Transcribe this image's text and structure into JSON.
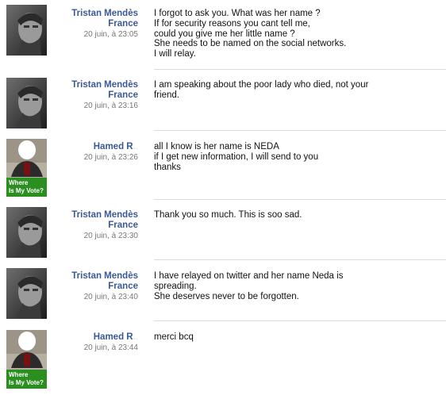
{
  "messages": [
    {
      "author_lines": [
        "Tristan Mendès",
        "France"
      ],
      "timestamp": "20 juin, à 23:05",
      "avatar": "tristan",
      "lines": [
        "I forgot to ask you. What was her name ?",
        "If for security reasons you cant tell me,",
        "could you give me her little name ?",
        "She needs to be named on the social networks.",
        "I will relay."
      ]
    },
    {
      "author_lines": [
        "Tristan Mendès",
        "France"
      ],
      "timestamp": "20 juin, à 23:16",
      "avatar": "tristan",
      "lines": [
        "I am speaking about the poor lady who died, not your",
        "friend."
      ]
    },
    {
      "author_lines": [
        "Hamed R"
      ],
      "timestamp": "20 juin, à 23:26",
      "avatar": "hamed",
      "badge": [
        "Where",
        "Is My Vote?"
      ],
      "lines": [
        "all I know is her name is NEDA",
        "if I get new information, I will send to you",
        "thanks"
      ]
    },
    {
      "author_lines": [
        "Tristan Mendès",
        "France"
      ],
      "timestamp": "20 juin, à 23:30",
      "avatar": "tristan",
      "lines": [
        "Thank you so much. This is soo sad."
      ]
    },
    {
      "author_lines": [
        "Tristan Mendès",
        "France"
      ],
      "timestamp": "20 juin, à 23:40",
      "avatar": "tristan",
      "lines": [
        "I have relayed on twitter and her name Neda is",
        "spreading.",
        "She deserves never to be forgotten."
      ]
    },
    {
      "author_lines": [
        "Hamed R"
      ],
      "timestamp": "20 juin, à 23:44",
      "avatar": "hamed",
      "badge": [
        "Where",
        "Is My Vote?"
      ],
      "lines": [
        "merci bcq"
      ]
    }
  ]
}
